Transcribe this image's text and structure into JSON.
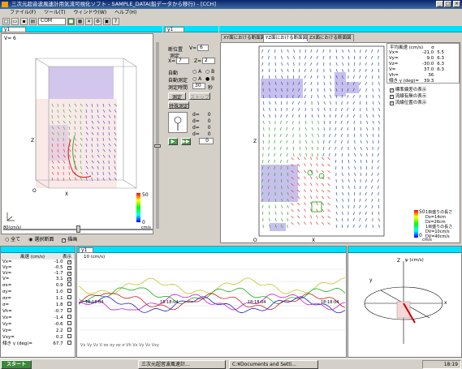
{
  "title": "三次元超音波風速計用気流可視化ソフト - SAMPLE_DATA(鉛データから移行) - [CCH]",
  "menu": [
    "ファイル(F)",
    "ツール(T)",
    "ウィンドウ(W)",
    "ヘルプ(H)"
  ],
  "toolbar_combo": "COM",
  "left_pane": {
    "combo": "y1",
    "v_label": "V= 6",
    "axes": {
      "z": "Z",
      "x": "X",
      "o": "O",
      "y": "y"
    },
    "colorbar": {
      "max": "50",
      "min": "0",
      "unit": "cm/s"
    },
    "scale_label": "80(cm/s)",
    "radio": [
      "全て",
      "選択断面",
      "描画"
    ]
  },
  "middle_pane": {
    "combo": "y1",
    "section_label": "断位置",
    "section_value": "6",
    "measure_label": "測定",
    "x_label": "X=",
    "x_value": "7",
    "z_label": "Z=",
    "z_value": "2",
    "radio_a": "自動",
    "radio_b": "手動",
    "auto_measure": "自動測定",
    "interval_label": "測定時間",
    "interval_value": "30",
    "interval_unit": "秒",
    "btn_measure": "測定",
    "btn_stop": "ストップ",
    "btn_special": "特殊測定",
    "readouts": [
      {
        "l": "d=",
        "v": "0"
      },
      {
        "l": "d=",
        "v": "0"
      },
      {
        "l": "d=",
        "v": "0"
      },
      {
        "l": "d=",
        "v": "0"
      }
    ],
    "counter": "0"
  },
  "right_pane": {
    "tabs": [
      "XY面における断面図",
      "YZ面における断面図",
      "ZX面における断面図"
    ],
    "stats_title": "平均風速 (cm/s)",
    "stats_header": [
      "",
      "σ"
    ],
    "stats": [
      {
        "k": "Vx=",
        "v": "-21.0",
        "s": "5.5"
      },
      {
        "k": "Vy=",
        "v": "9.0",
        "s": "6.3"
      },
      {
        "k": "Vz=",
        "v": "-30.0",
        "s": "6.3"
      },
      {
        "k": "V=",
        "v": "37.0",
        "s": "6.3"
      },
      {
        "k": "Vh=",
        "v": "36",
        "s": ""
      },
      {
        "k": "傾き γ (deg)=",
        "v": "39.3",
        "s": ""
      }
    ],
    "checks": [
      "標準偏差の表示",
      "流線有無の表示",
      "流線位置の表示"
    ],
    "axis_z": "Z",
    "axis_x": "X",
    "origin": "O",
    "colorbar": {
      "max": "50",
      "min": "0",
      "unit": "cm/s"
    },
    "legend": [
      "1目盛りの長さ",
      "Dx=14cm",
      "Dz=26cm",
      "1目盛りの長さ",
      "DV=10cm/s",
      "DV=40cm/s"
    ]
  },
  "bottom_left": {
    "header": [
      "風速 (cm/s)",
      "表示"
    ],
    "rows": [
      {
        "k": "Vx=",
        "v": "-1.0",
        "c": true
      },
      {
        "k": "Vy=",
        "v": "-0.5",
        "c": true
      },
      {
        "k": "Vz=",
        "v": "-1.7",
        "c": true
      },
      {
        "k": "V=",
        "v": "3.1",
        "c": true
      },
      {
        "k": "σx=",
        "v": "0.9",
        "c": false
      },
      {
        "k": "σy=",
        "v": "1.0",
        "c": false
      },
      {
        "k": "σz=",
        "v": "1.1",
        "c": false
      },
      {
        "k": "σ=",
        "v": "1.8",
        "c": false
      },
      {
        "k": "Vh=",
        "v": "-0.7",
        "c": false
      },
      {
        "k": "Vx=",
        "v": "-1.4",
        "c": false
      },
      {
        "k": "Vy=",
        "v": "-0.6",
        "c": false
      },
      {
        "k": "Vz=",
        "v": "2.2",
        "c": false
      },
      {
        "k": "Vxy=",
        "v": "0.2",
        "c": false
      },
      {
        "k": "傾き γ (deg)=",
        "v": "67.7",
        "c": false
      }
    ]
  },
  "bottom_chart": {
    "combo": "y1",
    "ylabel": "10 (cm/s)",
    "time_labels": [
      "18:18:04",
      "18:18:04",
      "18:18:04",
      "18:18:04"
    ],
    "legend": "Vx Vy Vz V σx σy σz σ Vh Vx Vy Vz Vxy"
  },
  "bottom_right": {
    "axis_z": "Z",
    "axis_y": "y",
    "axis_x": "x",
    "angle_label": "ψ (cm/s)"
  },
  "taskbar": {
    "start": "スタート",
    "task1": "三次元超音波風速計...",
    "task2": "C:¥Documents and Setti...",
    "clock": "18:19"
  }
}
